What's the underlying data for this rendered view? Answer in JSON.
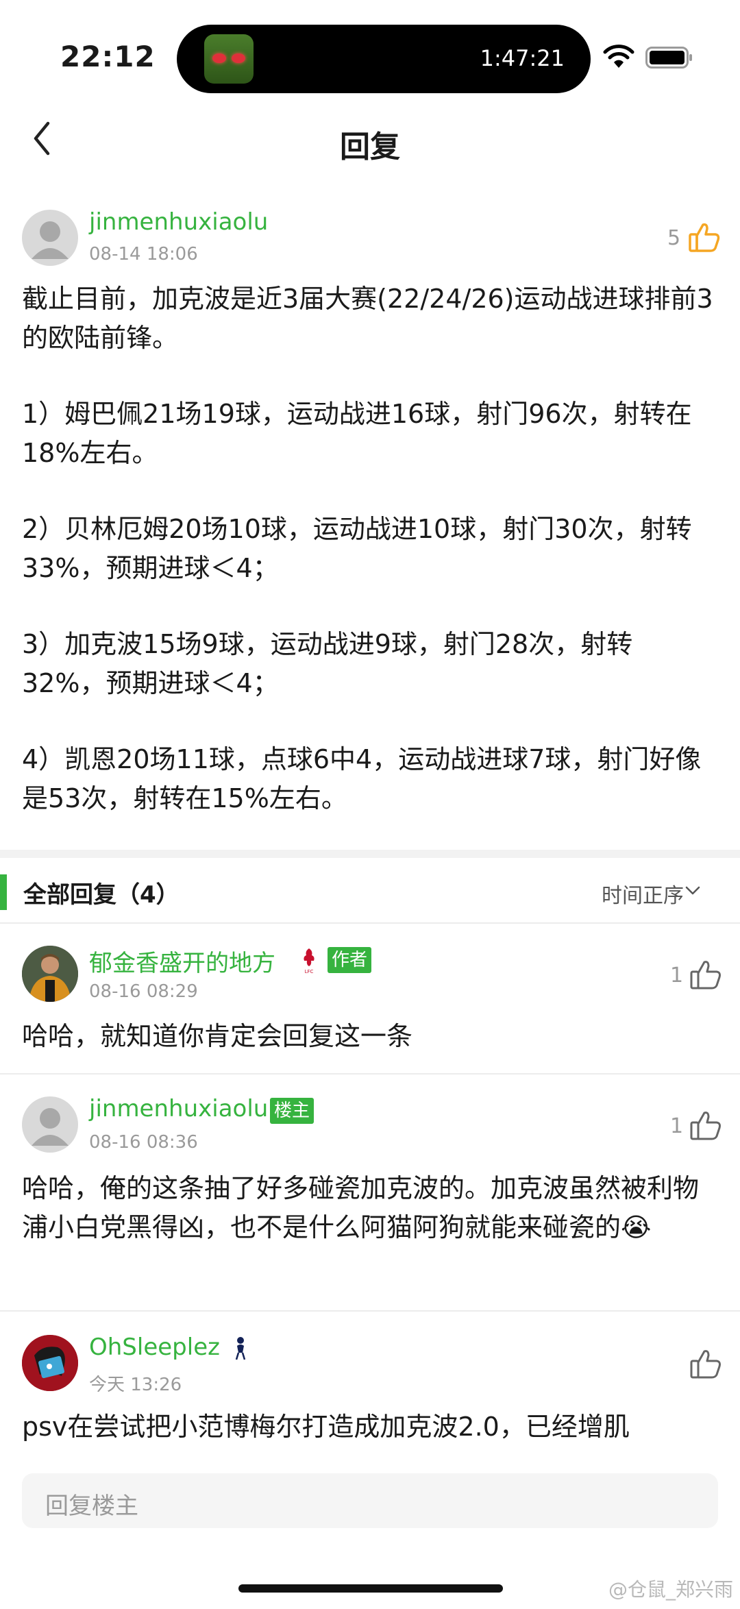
{
  "status_bar": {
    "time": "22:12",
    "island_timer": "1:47:21"
  },
  "nav": {
    "title": "回复"
  },
  "main_post": {
    "username": "jinmenhuxiaolu",
    "timestamp": "08-14 18:06",
    "like_count": "5",
    "paragraphs": [
      "截止目前，加克波是近3届大赛(22/24/26)运动战进球排前3的欧陆前锋。",
      "1）姆巴佩21场19球，运动战进16球，射门96次，射转在18%左右。",
      "2）贝林厄姆20场10球，运动战进10球，射门30次，射转33%，预期进球＜4；",
      "3）加克波15场9球，运动战进9球，射门28次，射转32%，预期进球＜4；",
      "4）凯恩20场11球，点球6中4，运动战进球7球，射门好像是53次，射转在15%左右。"
    ]
  },
  "replies_section": {
    "title": "全部回复（4）",
    "sort_label": "时间正序"
  },
  "replies": [
    {
      "username": "郁金香盛开的地方",
      "badge": "作者",
      "timestamp": "08-16 08:29",
      "like_count": "1",
      "text": "哈哈，就知道你肯定会回复这一条"
    },
    {
      "username": "jinmenhuxiaolu",
      "badge": "楼主",
      "timestamp": "08-16 08:36",
      "like_count": "1",
      "text": "哈哈，俺的这条抽了好多碰瓷加克波的。加克波虽然被利物浦小白党黑得凶，也不是什么阿猫阿狗就能来碰瓷的",
      "emoji": "😭"
    },
    {
      "username": "OhSleeplez",
      "timestamp": "今天 13:26",
      "text": "psv在尝试把小范博梅尔打造成加克波2.0，已经增肌"
    }
  ],
  "reply_input": {
    "placeholder": "回复楼主"
  },
  "watermark": "@仓鼠_郑兴雨"
}
